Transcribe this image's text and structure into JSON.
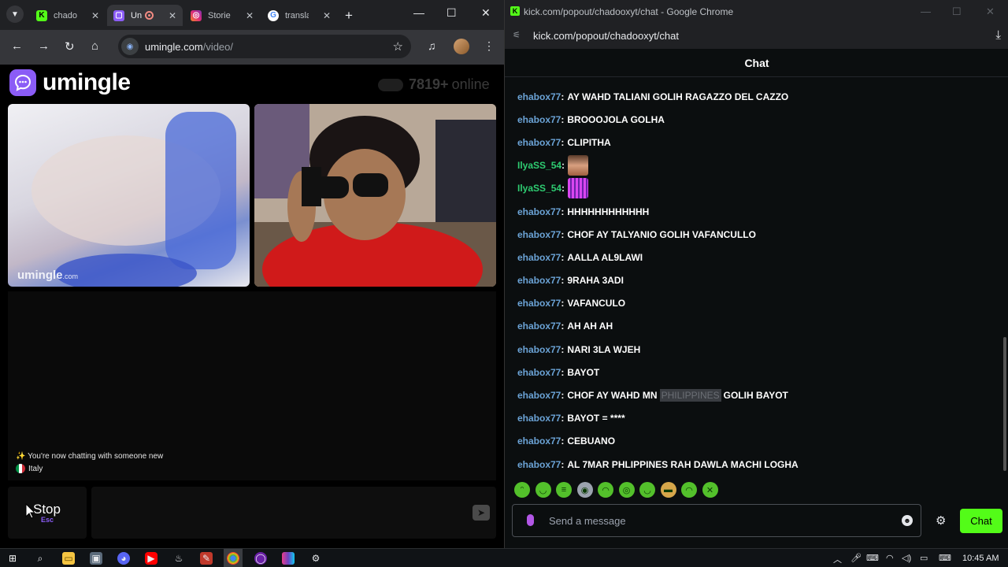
{
  "left_browser": {
    "tabs": [
      {
        "label": "chado",
        "favicon": "kick-icon",
        "color": "#53fc18"
      },
      {
        "label": "Un",
        "favicon": "umingle-icon",
        "color": "#8b5cf6",
        "recording": true
      },
      {
        "label": "Storie",
        "favicon": "instagram-icon",
        "color": "#e1306c"
      },
      {
        "label": "transla",
        "favicon": "google-icon",
        "color": "#4285f4"
      }
    ],
    "url_host": "umingle.com",
    "url_path": "/video/"
  },
  "umingle": {
    "brand": "umingle",
    "online_count": "7819+",
    "online_word": "online",
    "watermark": "umingle",
    "watermark_tld": ".com",
    "system_message": "You're now chatting with someone new",
    "country": "Italy",
    "stop_label": "Stop",
    "stop_hint": "Esc"
  },
  "right_browser": {
    "window_title": "kick.com/popout/chadooxyt/chat - Google Chrome",
    "url": "kick.com/popout/chadooxyt/chat",
    "chat_header": "Chat",
    "messages": [
      {
        "user": "ehabox77",
        "text": "AY WAHD TALIANI GOLIH RAGAZZO DEL CAZZO"
      },
      {
        "user": "ehabox77",
        "text": "BROOOJOLA GOLHA"
      },
      {
        "user": "ehabox77",
        "text": "CLIPITHA"
      },
      {
        "user": "IlyaSS_54",
        "emote": "face-emote",
        "color": "#c98a6a"
      },
      {
        "user": "IlyaSS_54",
        "emote": "equalizer-emote",
        "color": "#d946ef"
      },
      {
        "user": "ehabox77",
        "text": "HHHHHHHHHHHH"
      },
      {
        "user": "ehabox77",
        "text": "CHOF AY TALYANIO GOLIH VAFANCULLO"
      },
      {
        "user": "ehabox77",
        "text": "AALLA AL9LAWI"
      },
      {
        "user": "ehabox77",
        "text": "9RAHA 3ADI"
      },
      {
        "user": "ehabox77",
        "text": "VAFANCULO"
      },
      {
        "user": "ehabox77",
        "text": "AH AH AH"
      },
      {
        "user": "ehabox77",
        "text": "NARI 3LA WJEH"
      },
      {
        "user": "ehabox77",
        "text": "BAYOT"
      },
      {
        "user": "ehabox77",
        "text": "CHOF AY WAHD MN",
        "censored": "PHILIPPINES",
        "text_after": "GOLIH BAYOT"
      },
      {
        "user": "ehabox77",
        "text": "BAYOT = ****"
      },
      {
        "user": "ehabox77",
        "text": "CEBUANO"
      },
      {
        "user": "ehabox77",
        "text": "AL 7MAR PHLIPPINES RAH DAWLA MACHI LOGHA"
      }
    ],
    "input_placeholder": "Send a message",
    "chat_button": "Chat"
  },
  "taskbar": {
    "time": "10:45 AM"
  },
  "colors": {
    "kick_green": "#53fc18",
    "umingle_purple": "#8b5cf6",
    "username_blue": "#6ba3d6",
    "username_green": "#2ecc71"
  }
}
